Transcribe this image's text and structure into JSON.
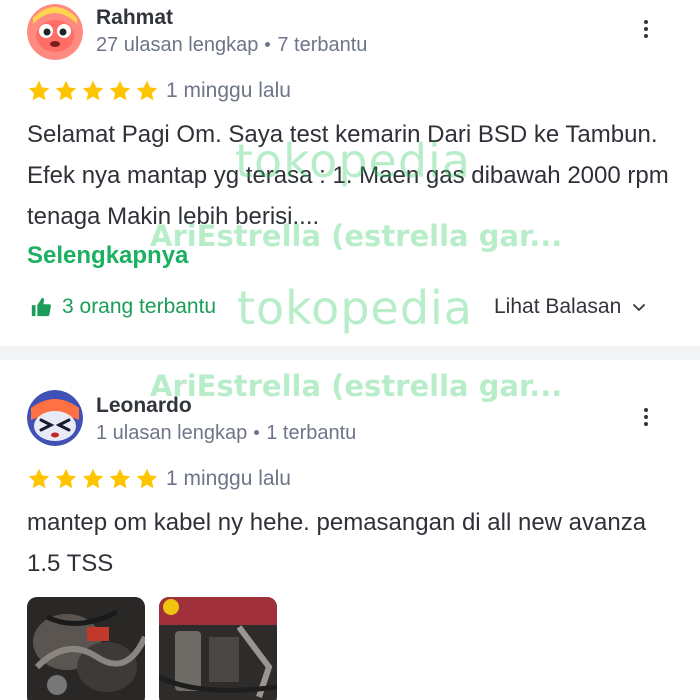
{
  "reviews": [
    {
      "reviewer_name": "Rahmat",
      "review_count": "27 ulasan lengkap",
      "helpful_count": "7 terbantu",
      "rating_stars": 5,
      "time_ago": "1 minggu lalu",
      "text": "Selamat Pagi Om. Saya test kemarin Dari BSD ke Tambun. Efek nya mantap yg terasa : 1. Maen gas dibawah 2000 rpm tenaga Makin lebih berisi....",
      "read_more": "Selengkapnya",
      "helpful_label": "3 orang terbantu",
      "replies_label": "Lihat Balasan"
    },
    {
      "reviewer_name": "Leonardo",
      "review_count": "1 ulasan lengkap",
      "helpful_count": "1 terbantu",
      "rating_stars": 5,
      "time_ago": "1 minggu lalu",
      "text": "mantep om kabel ny hehe. pemasangan di all new avanza 1.5 TSS",
      "photo_count": 2
    }
  ],
  "watermark": {
    "logo_text": "tokopedia",
    "seller_text": "AriEstrella (estrella gar..."
  },
  "colors": {
    "star": "#ffc400",
    "accent_green": "#1bb160",
    "helpful_green": "#1a9e57",
    "muted_text": "#6d7588"
  }
}
